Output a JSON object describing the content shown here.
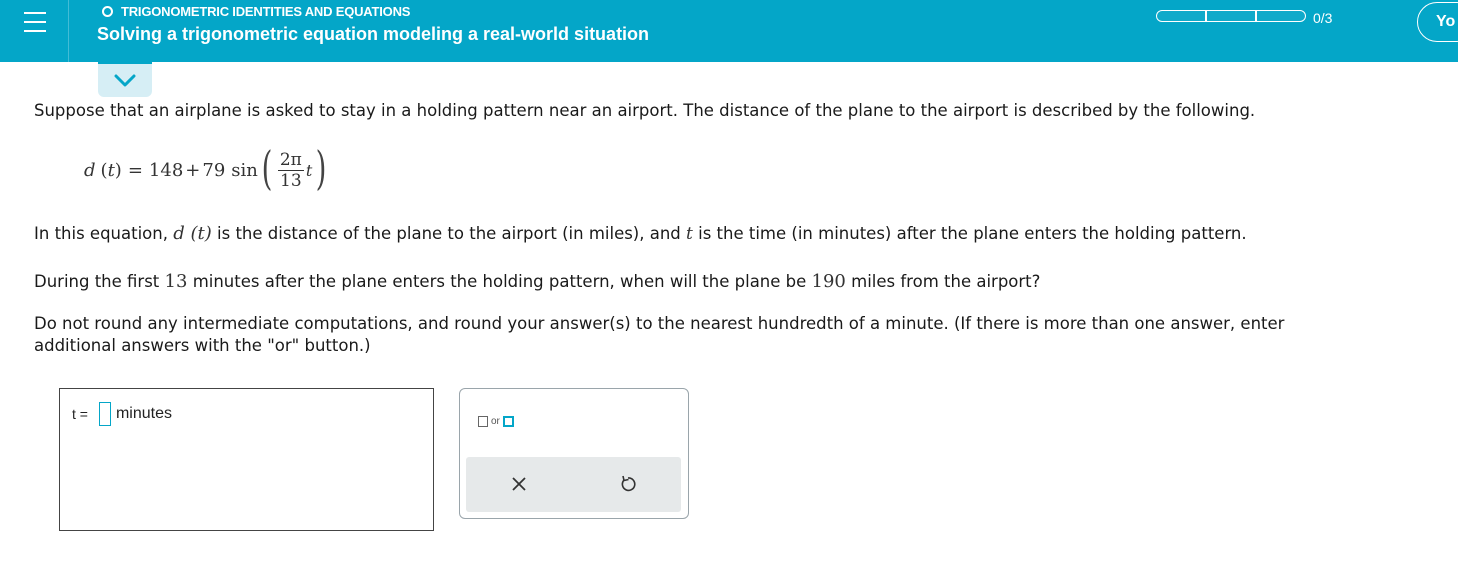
{
  "header": {
    "topic": "TRIGONOMETRIC IDENTITIES AND EQUATIONS",
    "title": "Solving a trigonometric equation modeling a real-world situation",
    "progress": {
      "count_text": "0/3",
      "completed": 0,
      "total": 3
    },
    "user_button_label": "Yo"
  },
  "problem": {
    "intro": "Suppose that an airplane is asked to stay in a holding pattern near an airport. The distance of the plane to the airport is described by the following.",
    "equation": {
      "lhs_func": "d",
      "lhs_var": "t",
      "equals": "=",
      "constant": "148",
      "plus": "+",
      "amplitude": "79",
      "sin": "sin",
      "frac_num": "2π",
      "frac_den": "13",
      "var": "t"
    },
    "definition": {
      "part1": "In this equation,",
      "func": "d",
      "var": "t",
      "part2": "is the distance of the plane to the airport (in miles), and",
      "part3": "is the time (in minutes) after the plane enters the holding pattern."
    },
    "question": {
      "part1": "During the first",
      "minutes_value": "13",
      "part2": "minutes after the plane enters the holding pattern, when will the plane be",
      "miles_value": "190",
      "part3": "miles from the airport?"
    },
    "instructions_line1": "Do not round any intermediate computations, and round your answer(s) to the nearest hundredth of a minute. (If there is more than one answer, enter",
    "instructions_line2": "additional answers with the \"or\" button.)"
  },
  "answer": {
    "variable_label": "t =",
    "input_value": "",
    "unit": "minutes"
  },
  "toolbar": {
    "or_label": "or",
    "clear_icon": "x-icon",
    "undo_icon": "undo-icon"
  },
  "colors": {
    "header_bg": "#04a6c8",
    "accent": "#04a6c8",
    "collapse_tab_bg": "#d6eef5",
    "action_bar_bg": "#e6e9ea"
  }
}
